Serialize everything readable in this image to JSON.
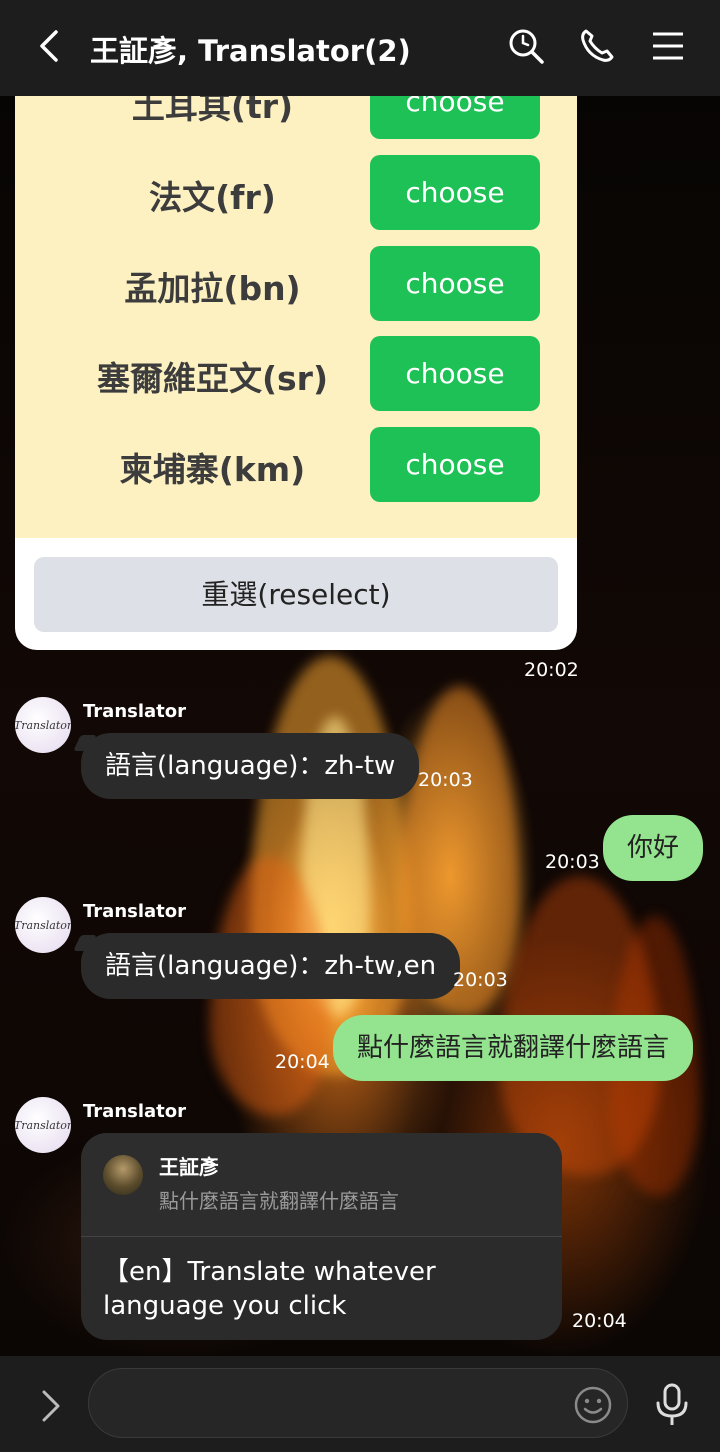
{
  "header": {
    "title": "王証彥, Translator(2)",
    "back_icon": "chevron-left-icon",
    "search_icon": "search-icon",
    "call_icon": "phone-icon",
    "menu_icon": "menu-icon"
  },
  "language_card": {
    "languages": [
      {
        "label": "土耳其(tr)",
        "button": "choose"
      },
      {
        "label": "法文(fr)",
        "button": "choose"
      },
      {
        "label": "孟加拉(bn)",
        "button": "choose"
      },
      {
        "label": "塞爾維亞文(sr)",
        "button": "choose"
      },
      {
        "label": "柬埔寨(km)",
        "button": "choose"
      }
    ],
    "reselect_label": "重選(reselect)",
    "time": "20:02"
  },
  "messages": [
    {
      "sender": "Translator",
      "avatar_text": "Translator",
      "text": "語言(language)：zh-tw",
      "time": "20:03"
    },
    {
      "sender": "me",
      "text": "你好",
      "time": "20:03"
    },
    {
      "sender": "Translator",
      "avatar_text": "Translator",
      "text": "語言(language)：zh-tw,en",
      "time": "20:03"
    },
    {
      "sender": "me",
      "text": "點什麼語言就翻譯什麼語言",
      "time": "20:04"
    },
    {
      "sender": "Translator",
      "avatar_text": "Translator",
      "quote": {
        "name": "王証彥",
        "text": "點什麼語言就翻譯什麼語言"
      },
      "text": "【en】Translate whatever language you click",
      "time": "20:04"
    }
  ],
  "input_bar": {
    "expand_icon": "chevron-right-icon",
    "placeholder": "",
    "emoji_icon": "emoji-icon",
    "mic_icon": "microphone-icon"
  },
  "colors": {
    "header_bg": "#1d1d1d",
    "card_lang_bg": "#fdf1c2",
    "choose_button": "#1ec155",
    "reselect_button": "#dde0e6",
    "incoming_bubble": "#2b2b2b",
    "outgoing_bubble": "#94e38e"
  }
}
